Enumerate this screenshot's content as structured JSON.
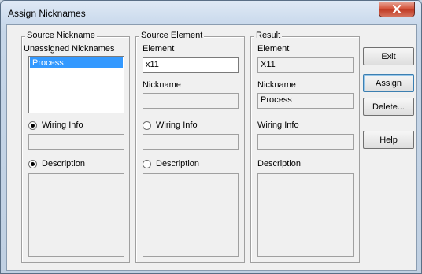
{
  "window": {
    "title": "Assign Nicknames"
  },
  "source_nickname": {
    "legend": "Source Nickname",
    "list_label": "Unassigned Nicknames",
    "items": [
      "Process"
    ],
    "selected": "Process",
    "wiring_label": "Wiring Info",
    "wiring_checked": true,
    "description_label": "Description",
    "description_checked": true
  },
  "source_element": {
    "legend": "Source Element",
    "element_label": "Element",
    "element_value": "x11",
    "nickname_label": "Nickname",
    "wiring_label": "Wiring Info",
    "wiring_checked": false,
    "description_label": "Description",
    "description_checked": false
  },
  "result": {
    "legend": "Result",
    "element_label": "Element",
    "element_value": "X11",
    "nickname_label": "Nickname",
    "nickname_value": "Process",
    "wiring_label": "Wiring Info",
    "description_label": "Description"
  },
  "buttons": {
    "exit": "Exit",
    "assign": "Assign",
    "delete": "Delete...",
    "help": "Help"
  }
}
